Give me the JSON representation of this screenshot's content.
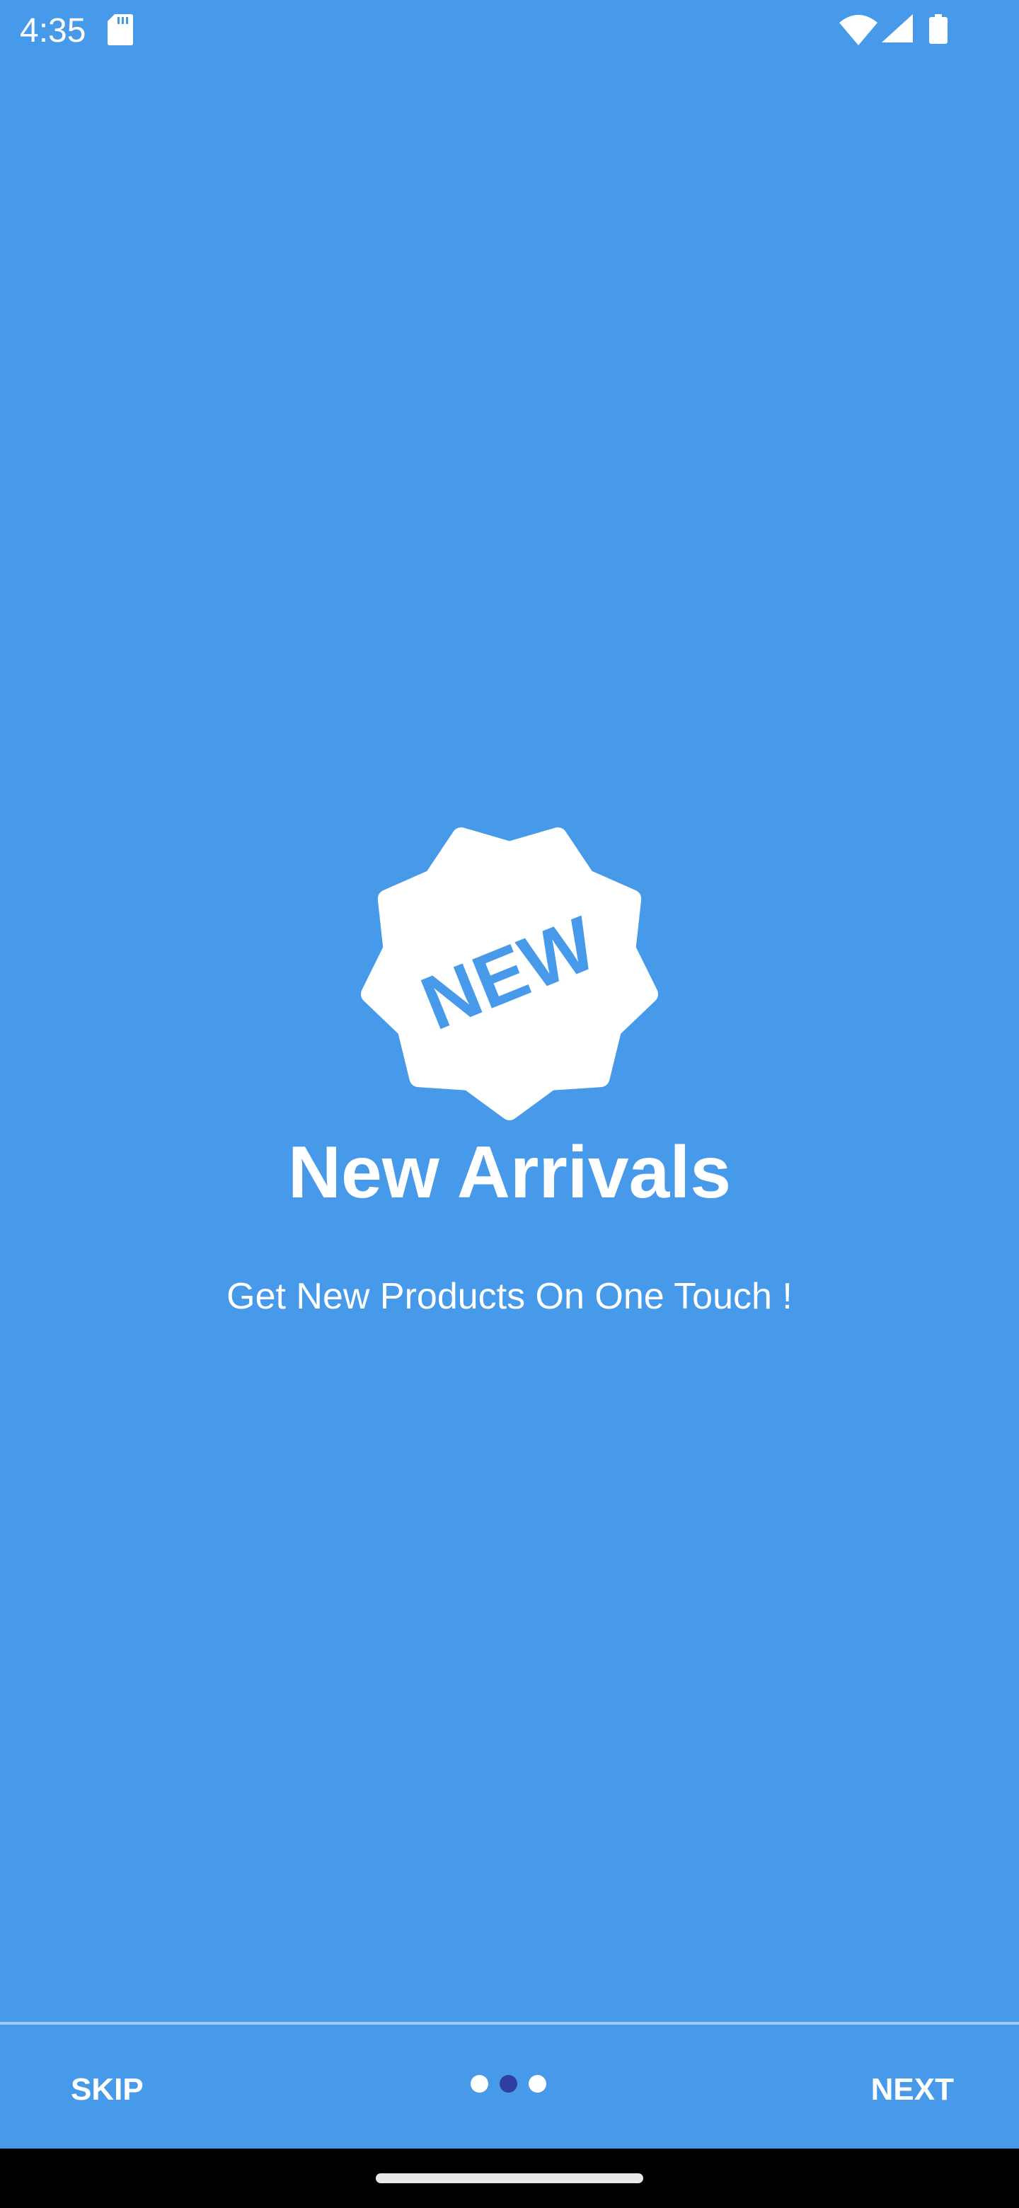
{
  "status_bar": {
    "time": "4:35",
    "icons": [
      "sd-card-icon",
      "wifi-icon",
      "signal-icon",
      "battery-icon"
    ]
  },
  "onboarding": {
    "badge_text": "NEW",
    "title": "New Arrivals",
    "subtitle": "Get New Products On One Touch !",
    "page_count": 3,
    "current_page": 2
  },
  "footer": {
    "skip_label": "SKIP",
    "next_label": "NEXT"
  },
  "colors": {
    "background": "#4799EA",
    "active_dot": "#303F9F",
    "inactive_dot": "#FFFFFF"
  }
}
